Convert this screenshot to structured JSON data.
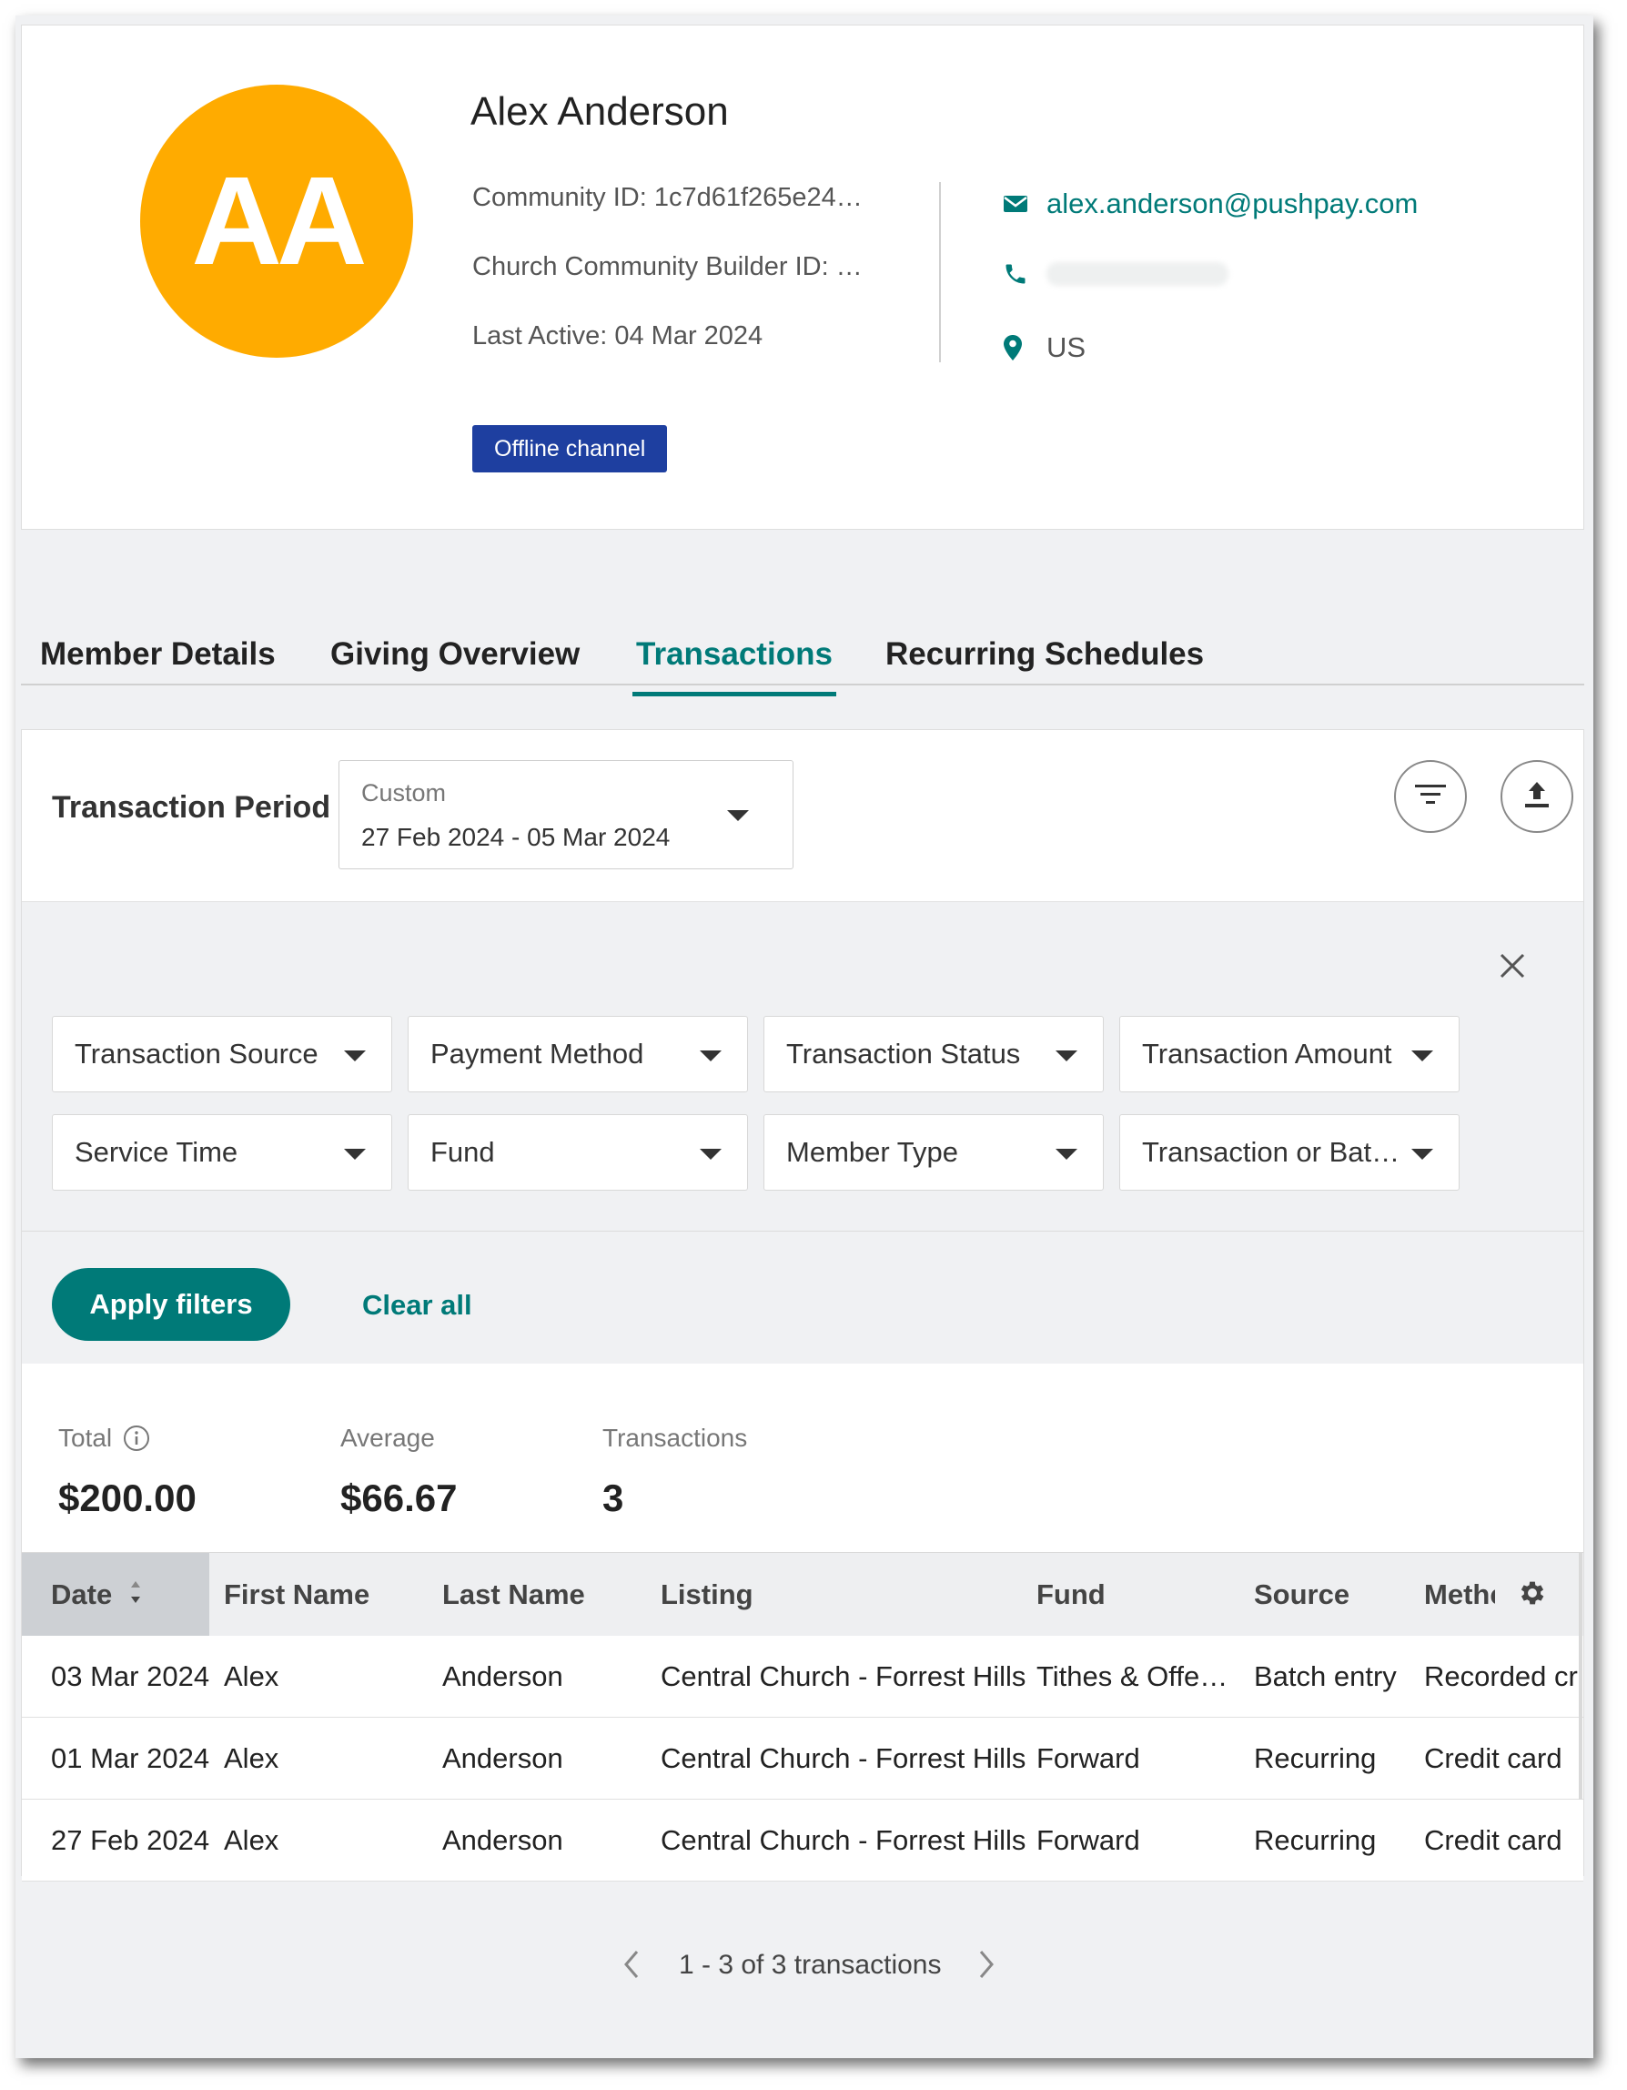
{
  "profile": {
    "initials": "AA",
    "name": "Alex Anderson",
    "community_id": "Community ID: 1c7d61f265e24…",
    "ccb_id": "Church Community Builder ID: …",
    "last_active": "Last Active: 04 Mar 2024",
    "email": "alex.anderson@pushpay.com",
    "country": "US",
    "badge": "Offline channel",
    "colors": {
      "avatar": "#ffab00",
      "accent": "#007a78",
      "badge": "#1e3fa0"
    }
  },
  "tabs": [
    {
      "label": "Member Details"
    },
    {
      "label": "Giving Overview"
    },
    {
      "label": "Transactions",
      "active": true
    },
    {
      "label": "Recurring Schedules"
    }
  ],
  "period": {
    "label": "Transaction Period",
    "mode": "Custom",
    "range": "27 Feb 2024 - 05 Mar 2024"
  },
  "filters": {
    "dropdowns": [
      "Transaction Source",
      "Payment Method",
      "Transaction Status",
      "Transaction Amount",
      "Service Time",
      "Fund",
      "Member Type",
      "Transaction or Bat…"
    ],
    "apply_label": "Apply filters",
    "clear_label": "Clear all"
  },
  "stats": {
    "total_label": "Total",
    "total_value": "$200.00",
    "average_label": "Average",
    "average_value": "$66.67",
    "count_label": "Transactions",
    "count_value": "3"
  },
  "table": {
    "headers": [
      "Date",
      "First Name",
      "Last Name",
      "Listing",
      "Fund",
      "Source",
      "Methc"
    ],
    "rows": [
      [
        "03 Mar 2024",
        "Alex",
        "Anderson",
        "Central Church - Forrest Hills",
        "Tithes & Offe…",
        "Batch entry",
        "Recorded cre"
      ],
      [
        "01 Mar 2024",
        "Alex",
        "Anderson",
        "Central Church - Forrest Hills",
        "Forward",
        "Recurring",
        "Credit card"
      ],
      [
        "27 Feb 2024",
        "Alex",
        "Anderson",
        "Central Church - Forrest Hills",
        "Forward",
        "Recurring",
        "Credit card"
      ]
    ]
  },
  "pagination": {
    "text": "1 - 3 of 3 transactions"
  },
  "icons": [
    "mail-icon",
    "phone-icon",
    "location-icon",
    "filter-icon",
    "export-icon",
    "close-icon",
    "info-icon",
    "sort-icon",
    "gear-icon",
    "chevron-left-icon",
    "chevron-right-icon",
    "caret-down-icon"
  ]
}
